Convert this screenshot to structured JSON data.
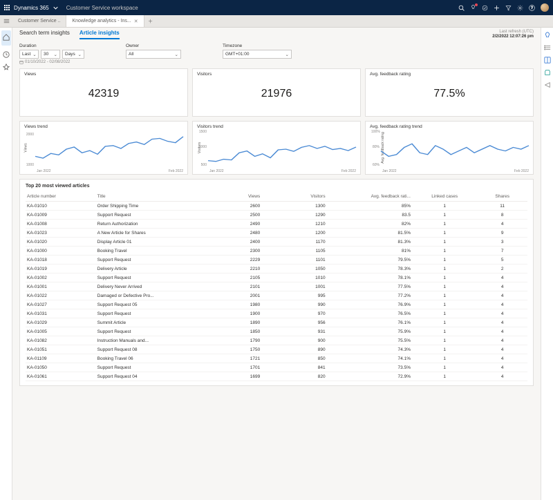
{
  "topbar": {
    "product": "Dynamics 365",
    "workspace": "Customer Service workspace"
  },
  "tabs": {
    "items": [
      {
        "label": "Customer Service ..",
        "active": false,
        "closable": false
      },
      {
        "label": "Knowledge analytics - Ins...",
        "active": true,
        "closable": true
      }
    ]
  },
  "subtabs": {
    "items": [
      {
        "label": "Search term insights",
        "active": false
      },
      {
        "label": "Article insights",
        "active": true
      }
    ]
  },
  "refresh": {
    "label": "Last refresh (UTC)",
    "value": "2/2/2022 12:07:26 pm"
  },
  "filters": {
    "duration": {
      "label": "Duration",
      "period": "Last",
      "amount": "30",
      "unit": "Days",
      "range": "01/10/2022 - 02/08/2022"
    },
    "owner": {
      "label": "Owner",
      "value": "All"
    },
    "timezone": {
      "label": "Timezone",
      "value": "GMT+01:00"
    }
  },
  "kpis": {
    "views": {
      "title": "Views",
      "value": "42319"
    },
    "visitors": {
      "title": "Visitors",
      "value": "21976"
    },
    "feedback": {
      "title": "Avg. feedback rating",
      "value": "77.5%"
    }
  },
  "chart_data": [
    {
      "id": "views_trend",
      "title": "Views trend",
      "type": "line",
      "xlabel": "",
      "ylabel": "Views",
      "x_start": "Jan 2022",
      "x_end": "Feb 2022",
      "ylim": [
        1000,
        2000
      ],
      "yticks": [
        1000,
        2000
      ],
      "values": [
        1300,
        1250,
        1380,
        1340,
        1500,
        1560,
        1400,
        1460,
        1360,
        1580,
        1600,
        1520,
        1660,
        1700,
        1630,
        1780,
        1800,
        1720,
        1680,
        1850
      ]
    },
    {
      "id": "visitors_trend",
      "title": "Visitors trend",
      "type": "line",
      "xlabel": "",
      "ylabel": "Visitors",
      "x_start": "Jan 2022",
      "x_end": "Feb 2022",
      "ylim": [
        500,
        1500
      ],
      "yticks": [
        500,
        1000,
        1500
      ],
      "values": [
        680,
        660,
        720,
        700,
        900,
        950,
        800,
        870,
        760,
        980,
        1000,
        940,
        1050,
        1100,
        1020,
        1080,
        990,
        1020,
        960,
        1060
      ]
    },
    {
      "id": "feedback_trend",
      "title": "Avg. feedback rating trend",
      "type": "line",
      "xlabel": "",
      "ylabel": "Avg. feedback rating",
      "x_start": "Jan 2022",
      "x_end": "Feb 2022",
      "ylim": [
        60,
        100
      ],
      "yticks": [
        60,
        80,
        100
      ],
      "values": [
        78,
        72,
        74,
        82,
        86,
        76,
        74,
        84,
        80,
        74,
        78,
        82,
        76,
        80,
        84,
        80,
        78,
        82,
        80,
        84
      ]
    }
  ],
  "table": {
    "title": "Top 20 most viewed articles",
    "columns": {
      "article": "Article number",
      "titlecol": "Title",
      "views": "Views",
      "visitors": "Visitors",
      "feedback": "Avg. feedback rati...",
      "linked": "Linked cases",
      "shares": "Shares"
    },
    "rows": [
      {
        "article": "KA-01010",
        "title": "Order Shipping Time",
        "views": "2600",
        "visitors": "1300",
        "feedback": "85%",
        "linked": "1",
        "shares": "11"
      },
      {
        "article": "KA-01009",
        "title": "Support Request",
        "views": "2500",
        "visitors": "1290",
        "feedback": "83.5",
        "linked": "1",
        "shares": "8"
      },
      {
        "article": "KA-01008",
        "title": "Return Authorization",
        "views": "2490",
        "visitors": "1210",
        "feedback": "82%",
        "linked": "1",
        "shares": "4"
      },
      {
        "article": "KA-01023",
        "title": "A New Article for Shares",
        "views": "2480",
        "visitors": "1200",
        "feedback": "81.5%",
        "linked": "1",
        "shares": "9"
      },
      {
        "article": "KA-01020",
        "title": "Display Article 01",
        "views": "2400",
        "visitors": "1170",
        "feedback": "81.3%",
        "linked": "1",
        "shares": "3"
      },
      {
        "article": "KA-01000",
        "title": "Booking Travel",
        "views": "2300",
        "visitors": "1105",
        "feedback": "81%",
        "linked": "1",
        "shares": "7"
      },
      {
        "article": "KA-01018",
        "title": "Support Request",
        "views": "2229",
        "visitors": "1101",
        "feedback": "79.5%",
        "linked": "1",
        "shares": "5"
      },
      {
        "article": "KA-01019",
        "title": "Delivery Article",
        "views": "2210",
        "visitors": "1050",
        "feedback": "78.3%",
        "linked": "1",
        "shares": "2"
      },
      {
        "article": "KA-01002",
        "title": "Support Request",
        "views": "2105",
        "visitors": "1010",
        "feedback": "78.1%",
        "linked": "1",
        "shares": "4"
      },
      {
        "article": "KA-01001",
        "title": "Delivery Never Arrived",
        "views": "2101",
        "visitors": "1001",
        "feedback": "77.5%",
        "linked": "1",
        "shares": "4"
      },
      {
        "article": "KA-01022",
        "title": "Damaged or Defective Pro...",
        "views": "2001",
        "visitors": "995",
        "feedback": "77.2%",
        "linked": "1",
        "shares": "4"
      },
      {
        "article": "KA-01027",
        "title": "Support Request 05",
        "views": "1980",
        "visitors": "990",
        "feedback": "76.9%",
        "linked": "1",
        "shares": "4"
      },
      {
        "article": "KA-01031",
        "title": "Support Request",
        "views": "1900",
        "visitors": "970",
        "feedback": "76.5%",
        "linked": "1",
        "shares": "4"
      },
      {
        "article": "KA-01029",
        "title": "Summit Article",
        "views": "1890",
        "visitors": "956",
        "feedback": "76.1%",
        "linked": "1",
        "shares": "4"
      },
      {
        "article": "KA-01005",
        "title": "Support Request",
        "views": "1850",
        "visitors": "931",
        "feedback": "75.9%",
        "linked": "1",
        "shares": "4"
      },
      {
        "article": "KA-01082",
        "title": "Instruction Manuals and...",
        "views": "1790",
        "visitors": "900",
        "feedback": "75.5%",
        "linked": "1",
        "shares": "4"
      },
      {
        "article": "KA-01051",
        "title": "Support Request 08",
        "views": "1750",
        "visitors": "890",
        "feedback": "74.3%",
        "linked": "1",
        "shares": "4"
      },
      {
        "article": "KA-01109",
        "title": "Booking Travel 06",
        "views": "1721",
        "visitors": "850",
        "feedback": "74.1%",
        "linked": "1",
        "shares": "4"
      },
      {
        "article": "KA-01050",
        "title": "Support Request",
        "views": "1701",
        "visitors": "841",
        "feedback": "73.5%",
        "linked": "1",
        "shares": "4"
      },
      {
        "article": "KA-01061",
        "title": "Support Request 04",
        "views": "1699",
        "visitors": "820",
        "feedback": "72.9%",
        "linked": "1",
        "shares": "4"
      }
    ]
  }
}
